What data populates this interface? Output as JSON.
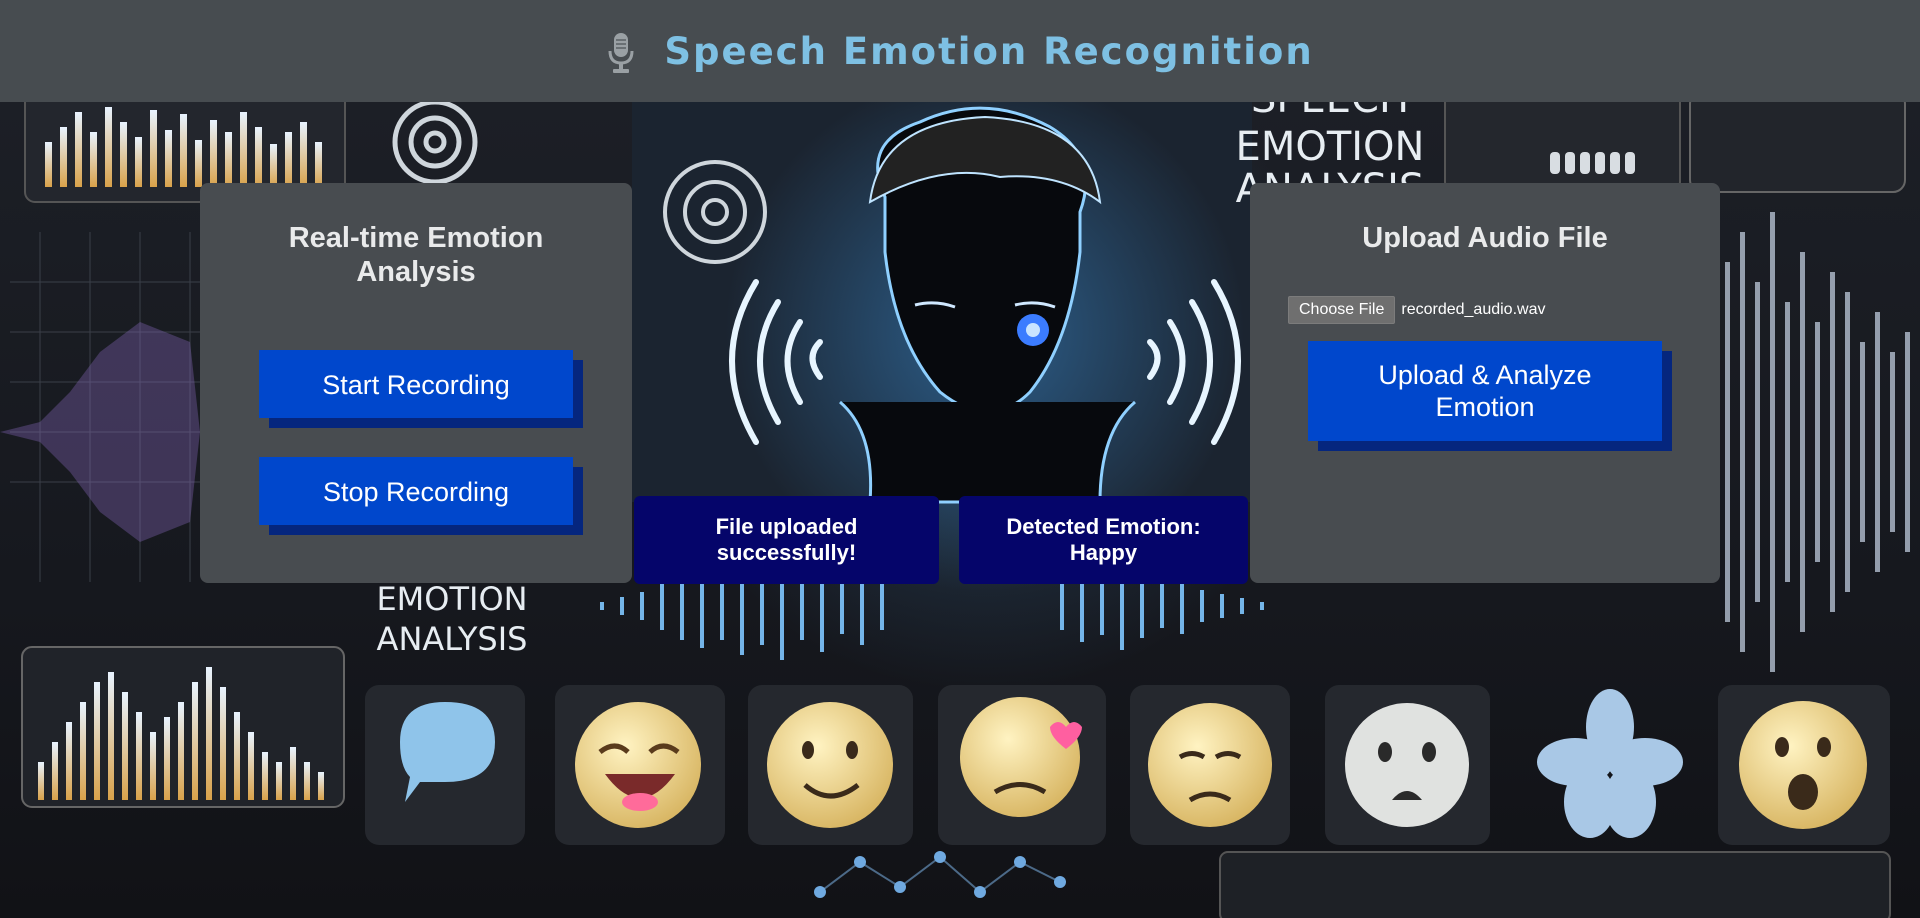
{
  "header": {
    "title": "Speech Emotion Recognition",
    "icon": "microphone-icon"
  },
  "background": {
    "art_text": [
      "SPEECH EMOTION ANALYSIS",
      "EMOTION ANALYSIS"
    ]
  },
  "realtime_panel": {
    "heading": "Real-time Emotion Analysis",
    "start_label": "Start Recording",
    "stop_label": "Stop Recording"
  },
  "upload_panel": {
    "heading": "Upload Audio File",
    "choose_label": "Choose File",
    "file_name": "recorded_audio.wav",
    "upload_label": "Upload & Analyze Emotion"
  },
  "status": {
    "upload_message": "File uploaded successfully!",
    "emotion_message": "Detected Emotion: Happy"
  },
  "colors": {
    "header_bg": "#474c50",
    "title": "#7ec0e3",
    "panel_bg": "#484c50",
    "button": "#0047cc",
    "button_shadow": "#05267e",
    "status_bg": "#05056a"
  }
}
